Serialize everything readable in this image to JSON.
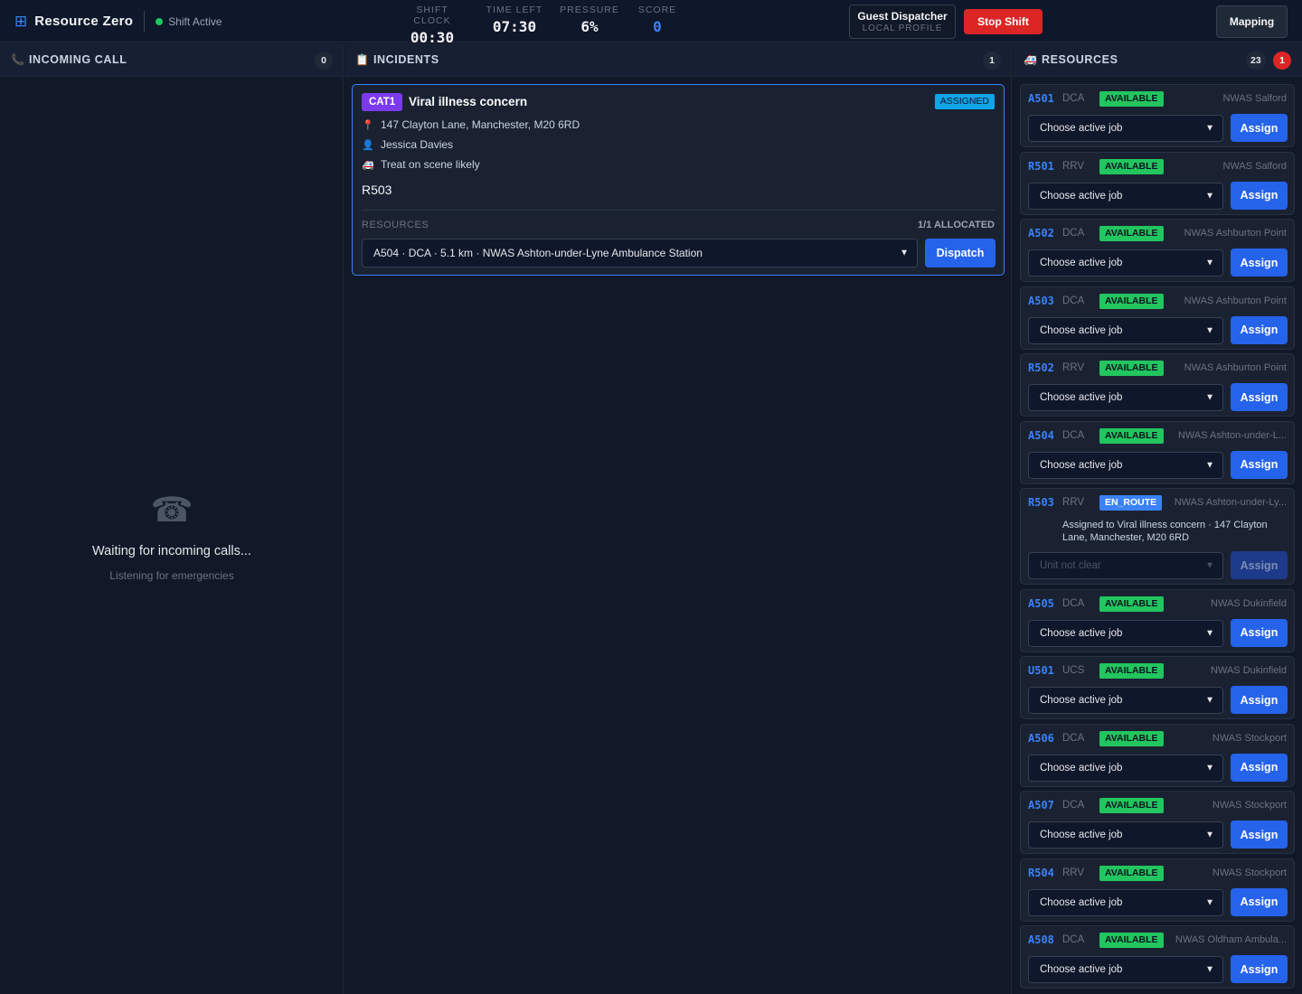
{
  "header": {
    "brand_icon": "⊞",
    "brand_title": "Resource Zero",
    "status_text": "Shift Active",
    "stats": [
      {
        "label": "SHIFT CLOCK",
        "value": "00:30"
      },
      {
        "label": "TIME LEFT",
        "value": "07:30"
      },
      {
        "label": "PRESSURE",
        "value": "6%"
      },
      {
        "label": "SCORE",
        "value": "0"
      }
    ],
    "profile_name": "Guest Dispatcher",
    "profile_sub": "LOCAL PROFILE",
    "stop_label": "Stop Shift",
    "mapping_label": "Mapping"
  },
  "incoming": {
    "title": "INCOMING CALL",
    "count": "0",
    "waiting_title": "Waiting for incoming calls...",
    "waiting_sub": "Listening for emergencies"
  },
  "incidents": {
    "title": "INCIDENTS",
    "count": "1",
    "card": {
      "category": "CAT1",
      "title": "Viral illness concern",
      "status": "ASSIGNED",
      "address": "147 Clayton Lane, Manchester, M20 6RD",
      "patient": "Jessica Davies",
      "disposition": "Treat on scene likely",
      "unit": "R503",
      "resources_label": "RESOURCES",
      "allocated": "1/1 ALLOCATED",
      "selected_resource": "A504 · DCA · 5.1 km · NWAS Ashton-under-Lyne Ambulance Station",
      "dispatch_label": "Dispatch"
    }
  },
  "resources": {
    "title": "RESOURCES",
    "count": "23",
    "alert_count": "1",
    "select_placeholder": "Choose active job",
    "assign_label": "Assign",
    "items": [
      {
        "id": "A501",
        "type": "DCA",
        "status": "AVAILABLE",
        "station": "NWAS Salford"
      },
      {
        "id": "R501",
        "type": "RRV",
        "status": "AVAILABLE",
        "station": "NWAS Salford"
      },
      {
        "id": "A502",
        "type": "DCA",
        "status": "AVAILABLE",
        "station": "NWAS Ashburton Point"
      },
      {
        "id": "A503",
        "type": "DCA",
        "status": "AVAILABLE",
        "station": "NWAS Ashburton Point"
      },
      {
        "id": "R502",
        "type": "RRV",
        "status": "AVAILABLE",
        "station": "NWAS Ashburton Point"
      },
      {
        "id": "A504",
        "type": "DCA",
        "status": "AVAILABLE",
        "station": "NWAS Ashton-under-L..."
      },
      {
        "id": "R503",
        "type": "RRV",
        "status": "EN_ROUTE",
        "station": "NWAS Ashton-under-Ly...",
        "note": "Assigned to Viral illness concern · 147 Clayton Lane, Manchester, M20 6RD",
        "select_text": "Unit not clear"
      },
      {
        "id": "A505",
        "type": "DCA",
        "status": "AVAILABLE",
        "station": "NWAS Dukinfield"
      },
      {
        "id": "U501",
        "type": "UCS",
        "status": "AVAILABLE",
        "station": "NWAS Dukinfield"
      },
      {
        "id": "A506",
        "type": "DCA",
        "status": "AVAILABLE",
        "station": "NWAS Stockport"
      },
      {
        "id": "A507",
        "type": "DCA",
        "status": "AVAILABLE",
        "station": "NWAS Stockport"
      },
      {
        "id": "R504",
        "type": "RRV",
        "status": "AVAILABLE",
        "station": "NWAS Stockport"
      },
      {
        "id": "A508",
        "type": "DCA",
        "status": "AVAILABLE",
        "station": "NWAS Oldham Ambula..."
      }
    ]
  },
  "colors": {
    "accent": "#3b82f6",
    "available": "#22c55e",
    "danger": "#dc2626",
    "category": "#7c3aed",
    "assigned": "#0ea5e9"
  }
}
